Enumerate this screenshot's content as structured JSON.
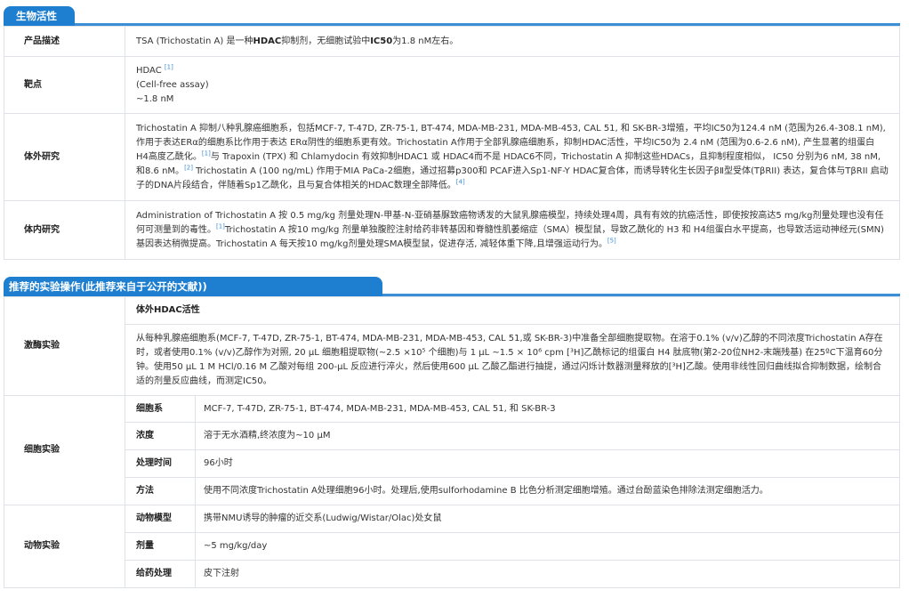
{
  "bio": {
    "tab": "生物活性",
    "rows": [
      {
        "label": "产品描述"
      },
      {
        "label": "靶点"
      },
      {
        "label": "体外研究"
      },
      {
        "label": "体内研究"
      }
    ],
    "desc_a": "TSA (Trichostatin A) 是一种",
    "desc_b": "HDAC",
    "desc_c": "抑制剂，无细胞试验中",
    "desc_d": "IC50",
    "desc_e": "为1.8 nM左右。",
    "target_line1": "HDAC",
    "target_ref": "[1]",
    "target_line2": "(Cell-free assay)",
    "target_line3": "~1.8 nM",
    "vitro_p1": "Trichostatin A 抑制八种乳腺癌细胞系，包括MCF-7, T-47D, ZR-75-1, BT-474, MDA-MB-231, MDA-MB-453, CAL 51, 和 SK-BR-3增殖，平均IC50为124.4 nM (范围为26.4-308.1 nM),作用于表达ERα的细胞系比作用于表达 ERα阴性的细胞系更有效。Trichostatin A作用于全部乳腺癌细胞系，抑制HDAC活性，平均IC50为 2.4 nM (范围为0.6-2.6 nM), 产生显著的组蛋白 H4高度乙酰化。",
    "vitro_ref1": "[1]",
    "vitro_p2": "与 Trapoxin (TPX) 和 Chlamydocin 有效抑制HDAC1 或 HDAC4而不是 HDAC6不同，Trichostatin A 抑制这些HDACs，且抑制程度相似， IC50 分别为6 nM, 38 nM, 和8.6 nM。",
    "vitro_ref2": "[2]",
    "vitro_p3": " Trichostatin A (100 ng/mL) 作用于MIA PaCa-2细胞，通过招募p300和 PCAF进入Sp1-NF-Y HDAC复合体，而诱导转化生长因子βⅡ型受体(TβRII) 表达，复合体与TβRII 启动子的DNA片段结合，伴随着Sp1乙酰化，且与复合体相关的HDAC数理全部降低。",
    "vitro_ref3": "[4]",
    "vivo_p1": "Administration of Trichostatin A 按 0.5 mg/kg 剂量处理N-甲基-N-亚硝基脲致癌物诱发的大鼠乳腺癌模型，持续处理4周，具有有效的抗癌活性，即使按按高达5 mg/kg剂量处理也没有任何可测量到的毒性。",
    "vivo_ref1": "[1]",
    "vivo_p2": "Trichostatin A 按10 mg/kg 剂量单独腹腔注射给药非转基因和脊髓性肌萎缩症（SMA）模型鼠，导致乙酰化的 H3 和 H4组蛋白水平提高，也导致活运动神经元(SMN) 基因表达稍微提高。Trichostatin A 每天按10 mg/kg剂量处理SMA模型鼠，促进存活, 减轻体重下降,且增强运动行为。",
    "vivo_ref2": "[5]"
  },
  "exp": {
    "tab": "推荐的实验操作(此推荐来自于公开的文献))",
    "enzyme_label": "激酶实验",
    "enzyme_title": "体外HDAC活性",
    "enzyme_text": "从每种乳腺癌细胞系(MCF-7, T-47D, ZR-75-1, BT-474, MDA-MB-231, MDA-MB-453, CAL 51,或 SK-BR-3)中准备全部细胞提取物。在溶于0.1% (v/v)乙醇的不同浓度Trichostatin A存在时，或者使用0.1% (v/v)乙醇作为对照, 20 μL 细胞粗提取物(~2.5 ×10⁵ 个细胞)与 1 μL ~1.5 × 10⁶ cpm [³H]乙酰标记的组蛋白 H4 肽底物(第2-20位NH2-末端残基) 在25ºC下温育60分钟。使用50 μL 1 M HCl/0.16 M 乙酸对每组 200-μL 反应进行淬火，然后使用600 μL 乙酸乙酯进行抽提，通过闪烁计数器测量释放的[³H]乙酸。使用非线性回归曲线拟合抑制数据，绘制合适的剂量反应曲线，而测定IC50。",
    "cell_label": "细胞实验",
    "cell_rows": [
      {
        "k": "细胞系",
        "v": "MCF-7, T-47D, ZR-75-1, BT-474, MDA-MB-231, MDA-MB-453, CAL 51, 和 SK-BR-3"
      },
      {
        "k": "浓度",
        "v": "溶于无水酒精,终浓度为~10 μM"
      },
      {
        "k": "处理时间",
        "v": "96小时"
      },
      {
        "k": "方法",
        "v": "使用不同浓度Trichostatin A处理细胞96小时。处理后,使用sulforhodamine B 比色分析测定细胞增殖。通过台酚蓝染色排除法测定细胞活力。"
      }
    ],
    "animal_label": "动物实验",
    "animal_rows": [
      {
        "k": "动物模型",
        "v": "携带NMU诱导的肿瘤的近交系(Ludwig/Wistar/Olac)处女鼠"
      },
      {
        "k": "剂量",
        "v": "~5 mg/kg/day"
      },
      {
        "k": "给药处理",
        "v": "皮下注射"
      }
    ]
  }
}
